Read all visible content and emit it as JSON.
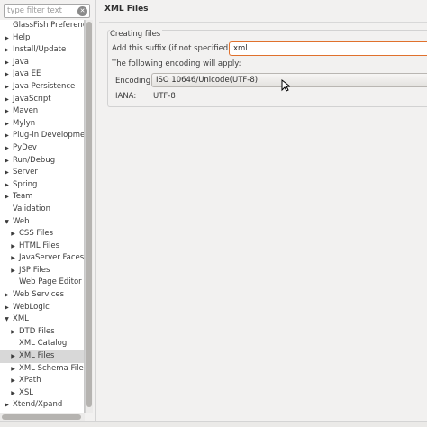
{
  "filter": {
    "placeholder": "type filter text"
  },
  "tree": [
    {
      "label": "GlassFish Preferences",
      "level": 0,
      "arrow": ""
    },
    {
      "label": "Help",
      "level": 0,
      "arrow": "right"
    },
    {
      "label": "Install/Update",
      "level": 0,
      "arrow": "right"
    },
    {
      "label": "Java",
      "level": 0,
      "arrow": "right"
    },
    {
      "label": "Java EE",
      "level": 0,
      "arrow": "right"
    },
    {
      "label": "Java Persistence",
      "level": 0,
      "arrow": "right"
    },
    {
      "label": "JavaScript",
      "level": 0,
      "arrow": "right"
    },
    {
      "label": "Maven",
      "level": 0,
      "arrow": "right"
    },
    {
      "label": "Mylyn",
      "level": 0,
      "arrow": "right"
    },
    {
      "label": "Plug-in Development",
      "level": 0,
      "arrow": "right"
    },
    {
      "label": "PyDev",
      "level": 0,
      "arrow": "right"
    },
    {
      "label": "Run/Debug",
      "level": 0,
      "arrow": "right"
    },
    {
      "label": "Server",
      "level": 0,
      "arrow": "right"
    },
    {
      "label": "Spring",
      "level": 0,
      "arrow": "right"
    },
    {
      "label": "Team",
      "level": 0,
      "arrow": "right"
    },
    {
      "label": "Validation",
      "level": 0,
      "arrow": ""
    },
    {
      "label": "Web",
      "level": 0,
      "arrow": "down"
    },
    {
      "label": "CSS Files",
      "level": 1,
      "arrow": "right"
    },
    {
      "label": "HTML Files",
      "level": 1,
      "arrow": "right"
    },
    {
      "label": "JavaServer Faces Tools",
      "level": 1,
      "arrow": "right"
    },
    {
      "label": "JSP Files",
      "level": 1,
      "arrow": "right"
    },
    {
      "label": "Web Page Editor",
      "level": 1,
      "arrow": ""
    },
    {
      "label": "Web Services",
      "level": 0,
      "arrow": "right"
    },
    {
      "label": "WebLogic",
      "level": 0,
      "arrow": "right"
    },
    {
      "label": "XML",
      "level": 0,
      "arrow": "down"
    },
    {
      "label": "DTD Files",
      "level": 1,
      "arrow": "right"
    },
    {
      "label": "XML Catalog",
      "level": 1,
      "arrow": ""
    },
    {
      "label": "XML Files",
      "level": 1,
      "arrow": "right",
      "selected": true
    },
    {
      "label": "XML Schema Files",
      "level": 1,
      "arrow": "right"
    },
    {
      "label": "XPath",
      "level": 1,
      "arrow": "right"
    },
    {
      "label": "XSL",
      "level": 1,
      "arrow": "right"
    },
    {
      "label": "Xtend/Xpand",
      "level": 0,
      "arrow": "right"
    }
  ],
  "page": {
    "title": "XML Files",
    "group_title": "Creating files",
    "suffix_label": "Add this suffix (if not specified):",
    "suffix_value": "xml",
    "encoding_note": "The following encoding will apply:",
    "encoding_label": "Encoding:",
    "encoding_value": "ISO 10646/Unicode(UTF-8)",
    "iana_label": "IANA:",
    "iana_value": "UTF-8"
  },
  "colors": {
    "focus_border": "#e0712d",
    "selection": "#d8d8d8"
  }
}
